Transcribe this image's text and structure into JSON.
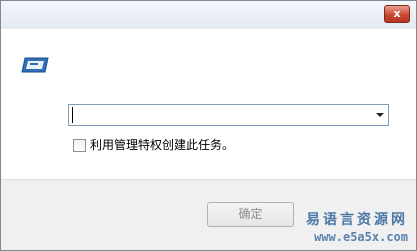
{
  "titlebar": {
    "close_label": "x"
  },
  "run_icon": "run-program-icon",
  "command": {
    "value": ""
  },
  "option": {
    "label": "利用管理特权创建此任务。",
    "checked": false
  },
  "buttons": {
    "ok_label": "确定"
  },
  "watermark": {
    "name": "易语言资源网",
    "url": "www.e5a5x.com"
  }
}
